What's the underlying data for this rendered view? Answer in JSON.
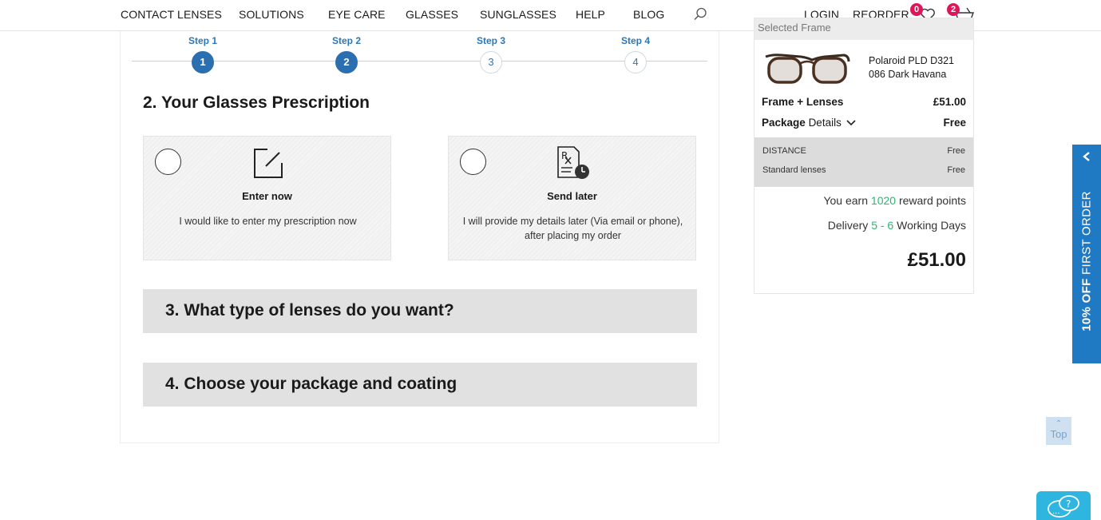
{
  "nav": {
    "items": [
      "CONTACT LENSES",
      "SOLUTIONS",
      "EYE CARE",
      "GLASSES",
      "SUNGLASSES",
      "HELP",
      "BLOG"
    ],
    "login": "LOGIN",
    "reorder": "REORDER",
    "wishlist_count": "0",
    "basket_count": "2",
    "icons": [
      "search-icon",
      "heart-icon",
      "basket-icon"
    ]
  },
  "steps": [
    {
      "label": "Step 1",
      "number": "1",
      "state": "done"
    },
    {
      "label": "Step 2",
      "number": "2",
      "state": "done"
    },
    {
      "label": "Step 3",
      "number": "3",
      "state": "todo"
    },
    {
      "label": "Step 4",
      "number": "4",
      "state": "todo"
    }
  ],
  "prescription": {
    "title": "2. Your Glasses Prescription",
    "options": [
      {
        "title": "Enter now",
        "description": "I would like to enter my prescription now",
        "icon": "edit-icon"
      },
      {
        "title": "Send later",
        "description": "I will provide my details later (Via email or phone), after placing my order",
        "icon": "prescription-clock-icon"
      }
    ]
  },
  "sections": [
    {
      "title": "3. What type of lenses do you want?"
    },
    {
      "title": "4. Choose your package and coating"
    }
  ],
  "summary": {
    "header": "Selected Frame",
    "frame_name": "Polaroid PLD D321 086 Dark Havana",
    "frame_lenses_label": "Frame + Lenses",
    "frame_lenses_price": "£51.00",
    "package_label": "Package",
    "details_label": "Details",
    "package_price": "Free",
    "lines": [
      {
        "label": "DISTANCE",
        "price": "Free"
      },
      {
        "label": "Standard lenses",
        "price": "Free"
      }
    ],
    "earn_prefix": "You earn",
    "reward_points": "1020",
    "earn_suffix": "reward points",
    "delivery_prefix": "Delivery",
    "delivery_days": "5 - 6",
    "delivery_suffix": "Working Days",
    "total": "£51.00"
  },
  "promo": {
    "bold": "10% OFF",
    "text": "FIRST ORDER"
  },
  "back_to_top": "Top",
  "colors": {
    "accent": "#2c6fb0",
    "badge": "#e0145a",
    "green": "#2bb673",
    "promo": "#1f79c3"
  }
}
